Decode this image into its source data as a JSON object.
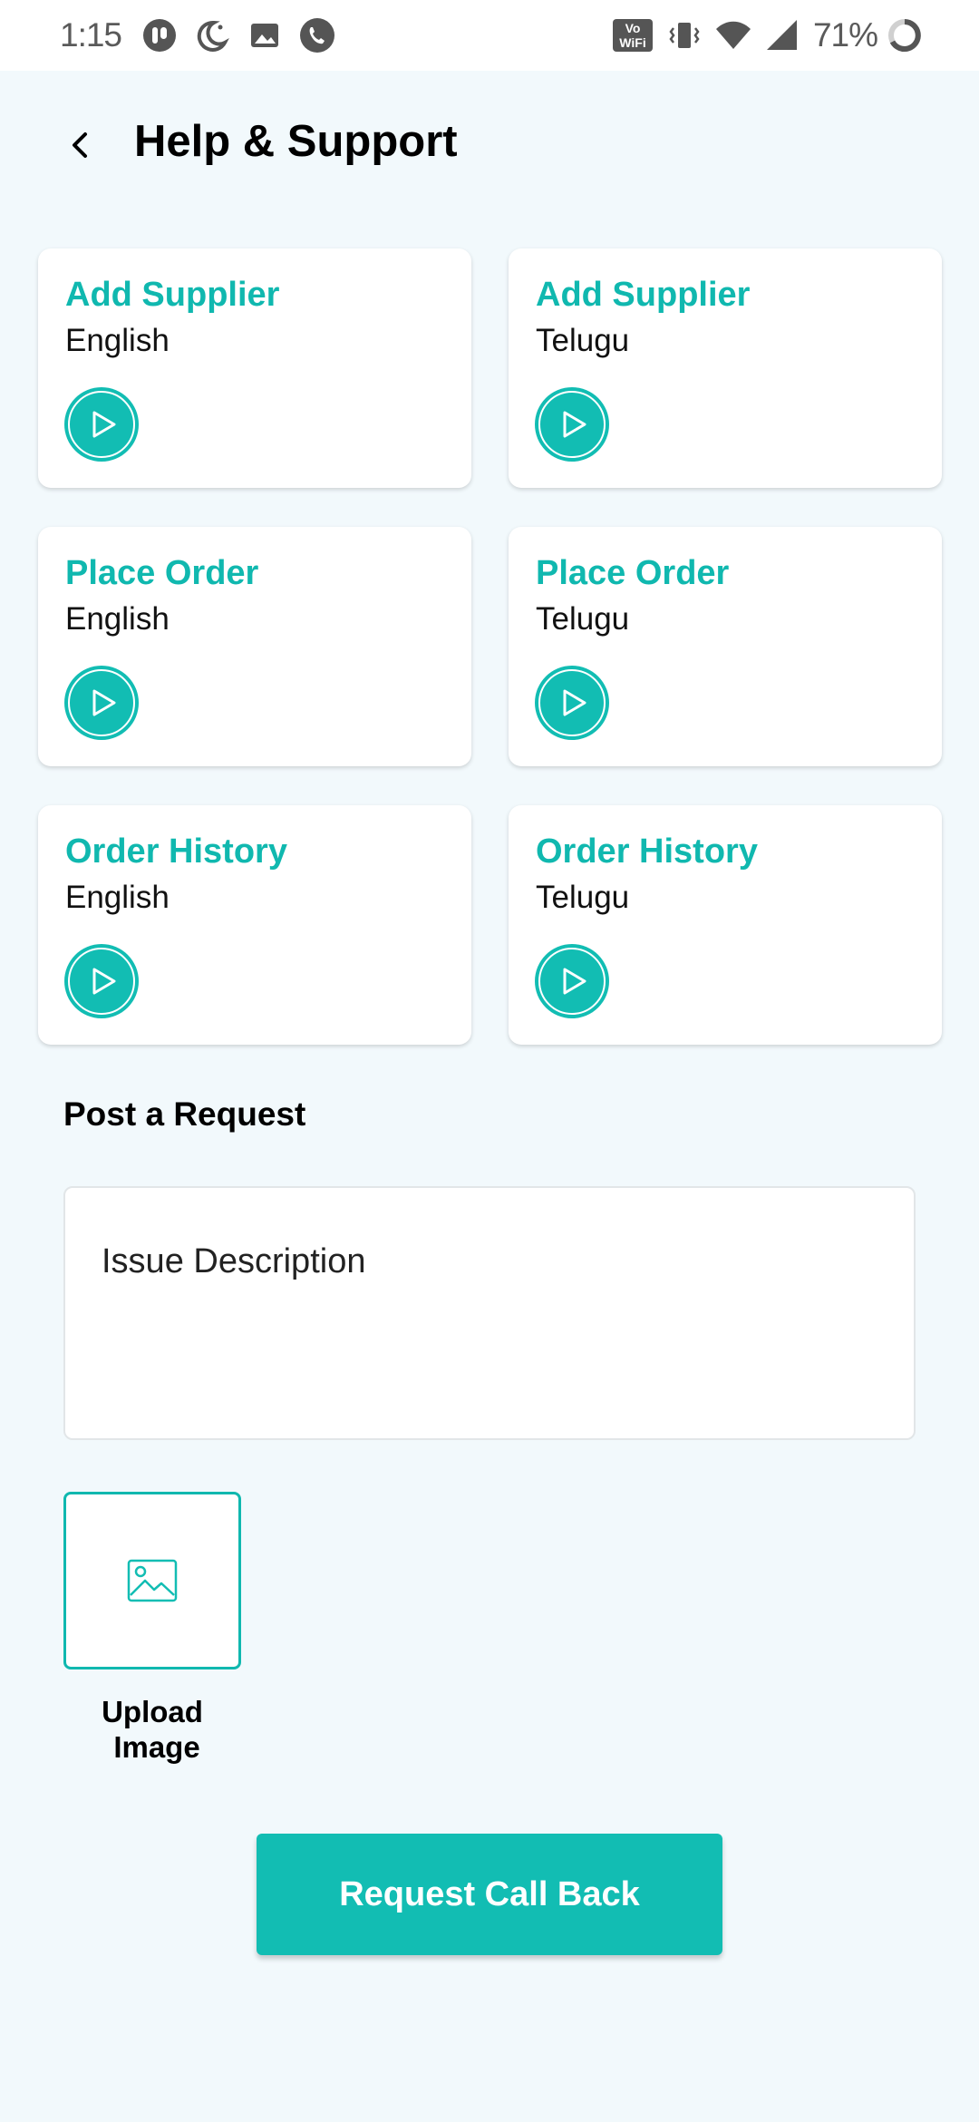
{
  "status_bar": {
    "time": "1:15",
    "battery": "71%",
    "icons_left": [
      "app-icon",
      "moon-icon",
      "image-icon",
      "phone-icon"
    ],
    "icons_right": [
      "vowifi-icon",
      "vibrate-icon",
      "wifi-icon",
      "signal-icon",
      "battery-ring-icon"
    ],
    "vowifi_top": "Vo",
    "vowifi_bottom": "WiFi"
  },
  "header": {
    "title": "Help & Support",
    "back_icon": "back-arrow-icon"
  },
  "tutorials": [
    {
      "title": "Add Supplier",
      "language": "English"
    },
    {
      "title": "Add Supplier",
      "language": "Telugu"
    },
    {
      "title": "Place Order",
      "language": "English"
    },
    {
      "title": "Place Order",
      "language": "Telugu"
    },
    {
      "title": "Order History",
      "language": "English"
    },
    {
      "title": "Order History",
      "language": "Telugu"
    }
  ],
  "request": {
    "section_title": "Post a Request",
    "issue_placeholder": "Issue Description",
    "upload_label_line1": "Upload",
    "upload_label_line2": "Image",
    "upload_icon": "image-icon",
    "cta_label": "Request Call Back"
  },
  "colors": {
    "accent": "#12bdb3",
    "background": "#f2f9fc",
    "card": "#ffffff"
  }
}
